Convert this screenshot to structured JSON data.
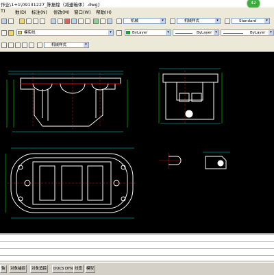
{
  "window": {
    "title": "作业\\1+1\\09131227_陈振煌（减速箱体）.dwg]",
    "badge": "42"
  },
  "menu": [
    "T)",
    "数(D)",
    "标注(N)",
    "修改(M)",
    "窗口(W)",
    "帮助(H)"
  ],
  "toolbar": {
    "text_style": "机械",
    "dim_style": "机械样式",
    "table_style": "Standard",
    "layer_name": "模实线",
    "color": "ByLayer",
    "linetype": "ByLayer",
    "lineweight": "ByLayer",
    "annot_style": "机械样式"
  },
  "status": [
    "轴",
    "对象捕捉",
    "对象追踪",
    "DUCS",
    "DYN",
    "线宽",
    "模型"
  ]
}
